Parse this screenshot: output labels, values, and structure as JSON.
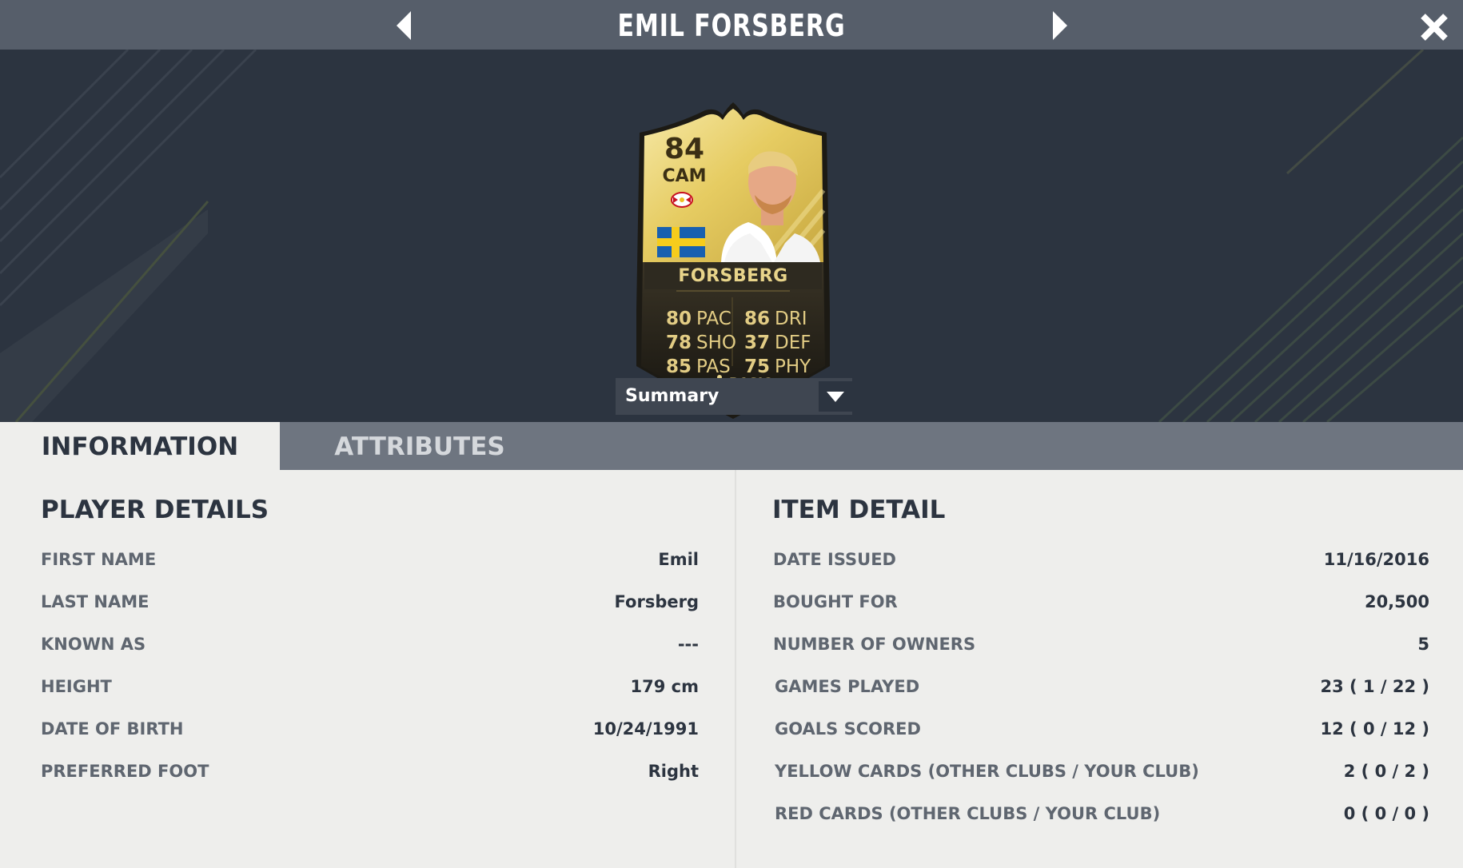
{
  "header": {
    "title": "EMIL FORSBERG"
  },
  "icons": {
    "prev": "caret-left-icon",
    "next": "caret-right-icon",
    "close": "close-x-icon",
    "dropdown": "chevron-down-icon",
    "club": "club-crest-icon",
    "nation": "sweden-flag-icon",
    "chemistry": "player-silhouette-icon"
  },
  "card": {
    "rating": "84",
    "position": "CAM",
    "name": "FORSBERG",
    "type": "BASIC",
    "stats": [
      {
        "value": "80",
        "label": "PAC"
      },
      {
        "value": "86",
        "label": "DRI"
      },
      {
        "value": "78",
        "label": "SHO"
      },
      {
        "value": "37",
        "label": "DEF"
      },
      {
        "value": "85",
        "label": "PAS"
      },
      {
        "value": "75",
        "label": "PHY"
      }
    ]
  },
  "dropdown": {
    "value": "Summary"
  },
  "tabs": {
    "information": "INFORMATION",
    "attributes": "ATTRIBUTES"
  },
  "player_details": {
    "title": "PLAYER DETAILS",
    "rows": [
      {
        "label": "FIRST NAME",
        "value": "Emil"
      },
      {
        "label": "LAST NAME",
        "value": "Forsberg"
      },
      {
        "label": "KNOWN AS",
        "value": "---"
      },
      {
        "label": "HEIGHT",
        "value": "179 cm"
      },
      {
        "label": "DATE OF BIRTH",
        "value": "10/24/1991"
      },
      {
        "label": "PREFERRED FOOT",
        "value": "Right"
      }
    ]
  },
  "item_detail": {
    "title": "ITEM DETAIL",
    "rows": [
      {
        "label": "DATE ISSUED",
        "value": "11/16/2016"
      },
      {
        "label": "BOUGHT FOR",
        "value": "20,500"
      },
      {
        "label": "NUMBER OF OWNERS",
        "value": "5"
      },
      {
        "label": "GAMES PLAYED",
        "value": "23 ( 1 / 22 )"
      },
      {
        "label": "GOALS SCORED",
        "value": "12 ( 0 / 12 )"
      },
      {
        "label": "YELLOW CARDS (OTHER CLUBS / YOUR CLUB)",
        "value": "2 ( 0 / 2 )"
      },
      {
        "label": "RED CARDS (OTHER CLUBS / YOUR CLUB)",
        "value": "0 ( 0 / 0 )"
      }
    ]
  },
  "colors": {
    "header": "#565e6a",
    "background": "#2c3440",
    "panel": "#eeeeec",
    "gold": "#e2cc84"
  }
}
